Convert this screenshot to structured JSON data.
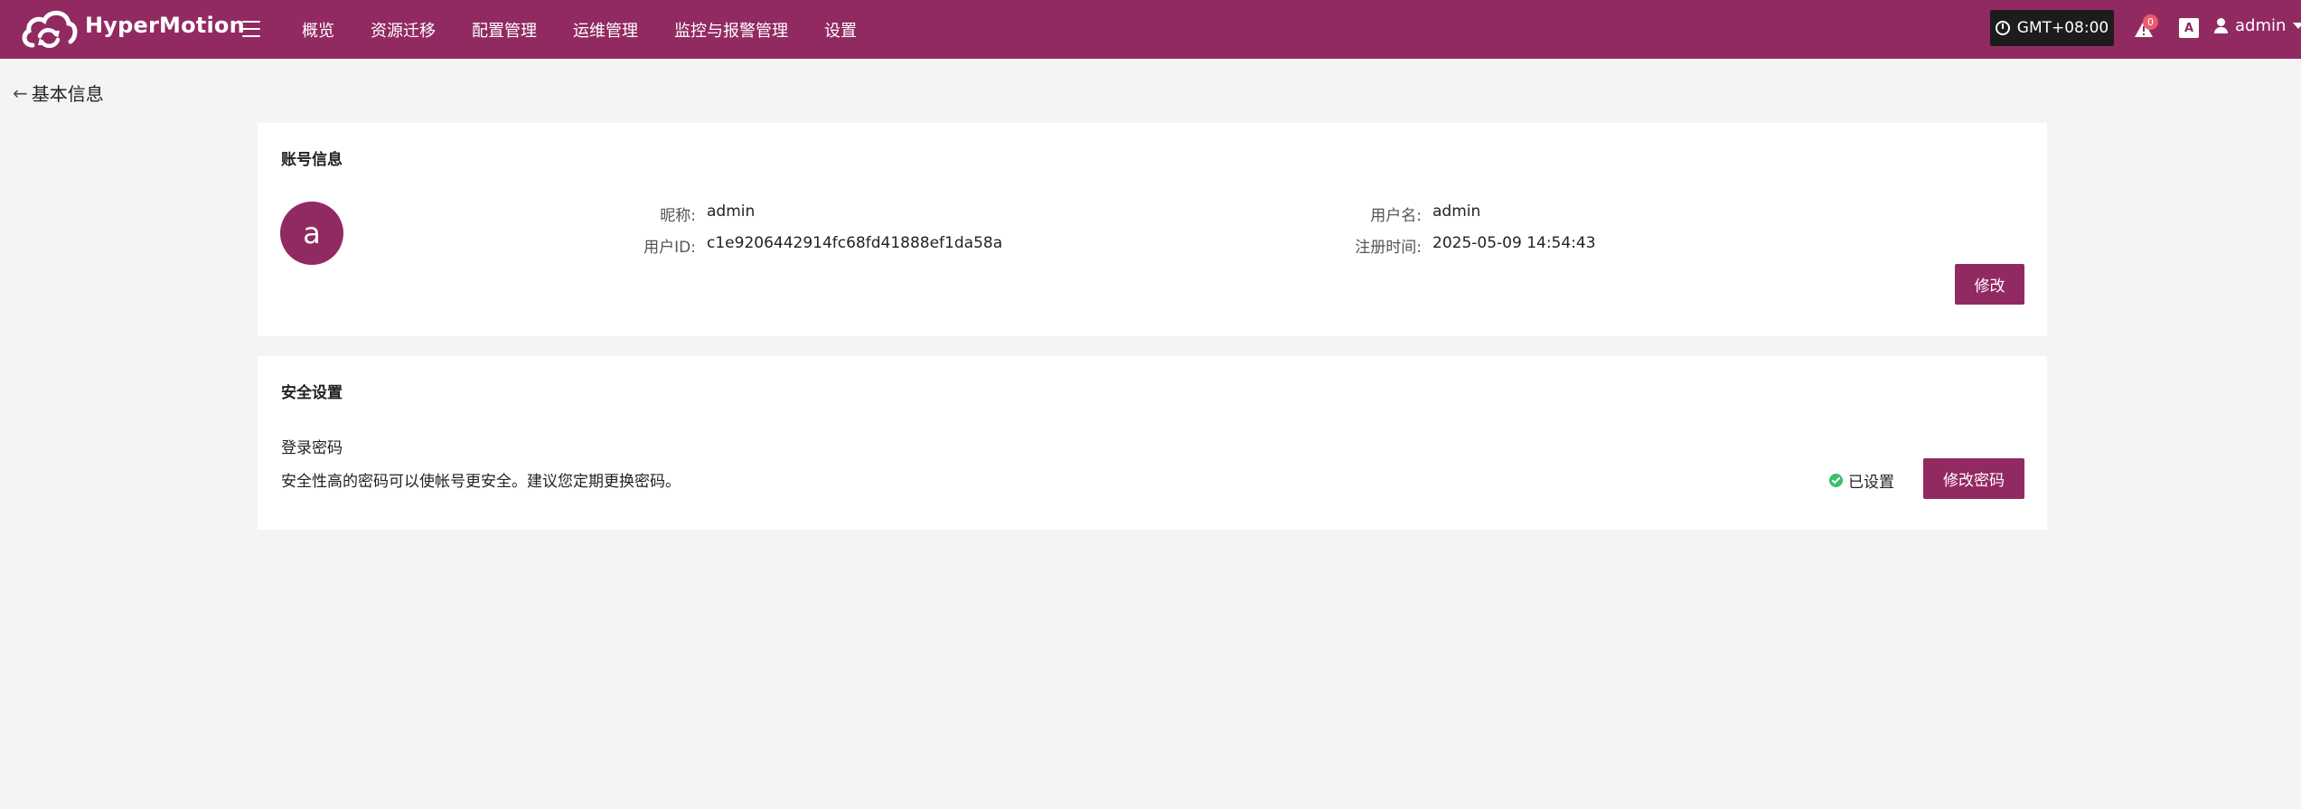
{
  "app": {
    "brand": "HyperMotion",
    "nav": [
      "概览",
      "资源迁移",
      "配置管理",
      "运维管理",
      "监控与报警管理",
      "设置"
    ],
    "timezone": "GMT+08:00",
    "alert_count": "0",
    "lang_label": "A",
    "user": "admin",
    "accent_color": "#922a62"
  },
  "page": {
    "back_icon": "←",
    "title": "基本信息"
  },
  "account": {
    "title": "账号信息",
    "avatar_letter": "a",
    "nickname_label": "昵称:",
    "nickname": "admin",
    "user_id_label": "用户ID:",
    "user_id": "c1e9206442914fc68fd41888ef1da58a",
    "username_label": "用户名:",
    "username": "admin",
    "registered_label": "注册时间:",
    "registered": "2025-05-09 14:54:43",
    "edit_button": "修改"
  },
  "security": {
    "title": "安全设置",
    "password_label": "登录密码",
    "password_desc": "安全性高的密码可以使帐号更安全。建议您定期更换密码。",
    "status": "已设置",
    "change_button": "修改密码"
  }
}
